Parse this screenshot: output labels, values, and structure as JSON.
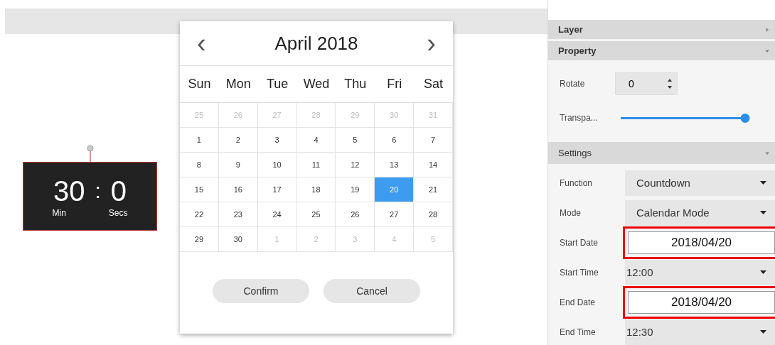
{
  "countdown": {
    "minutes": "30",
    "separator": ":",
    "seconds": "0",
    "minutes_label": "Min",
    "seconds_label": "Secs"
  },
  "calendar": {
    "title": "April 2018",
    "prev": "‹",
    "next": "›",
    "weekdays": [
      "Sun",
      "Mon",
      "Tue",
      "Wed",
      "Thu",
      "Fri",
      "Sat"
    ],
    "weeks": [
      [
        {
          "day": "25",
          "in_month": false,
          "selected": false
        },
        {
          "day": "26",
          "in_month": false,
          "selected": false
        },
        {
          "day": "27",
          "in_month": false,
          "selected": false
        },
        {
          "day": "28",
          "in_month": false,
          "selected": false
        },
        {
          "day": "29",
          "in_month": false,
          "selected": false
        },
        {
          "day": "30",
          "in_month": false,
          "selected": false
        },
        {
          "day": "31",
          "in_month": false,
          "selected": false
        }
      ],
      [
        {
          "day": "1",
          "in_month": true,
          "selected": false
        },
        {
          "day": "2",
          "in_month": true,
          "selected": false
        },
        {
          "day": "3",
          "in_month": true,
          "selected": false
        },
        {
          "day": "4",
          "in_month": true,
          "selected": false
        },
        {
          "day": "5",
          "in_month": true,
          "selected": false
        },
        {
          "day": "6",
          "in_month": true,
          "selected": false
        },
        {
          "day": "7",
          "in_month": true,
          "selected": false
        }
      ],
      [
        {
          "day": "8",
          "in_month": true,
          "selected": false
        },
        {
          "day": "9",
          "in_month": true,
          "selected": false
        },
        {
          "day": "10",
          "in_month": true,
          "selected": false
        },
        {
          "day": "11",
          "in_month": true,
          "selected": false
        },
        {
          "day": "12",
          "in_month": true,
          "selected": false
        },
        {
          "day": "13",
          "in_month": true,
          "selected": false
        },
        {
          "day": "14",
          "in_month": true,
          "selected": false
        }
      ],
      [
        {
          "day": "15",
          "in_month": true,
          "selected": false
        },
        {
          "day": "16",
          "in_month": true,
          "selected": false
        },
        {
          "day": "17",
          "in_month": true,
          "selected": false
        },
        {
          "day": "18",
          "in_month": true,
          "selected": false
        },
        {
          "day": "19",
          "in_month": true,
          "selected": false
        },
        {
          "day": "20",
          "in_month": true,
          "selected": true
        },
        {
          "day": "21",
          "in_month": true,
          "selected": false
        }
      ],
      [
        {
          "day": "22",
          "in_month": true,
          "selected": false
        },
        {
          "day": "23",
          "in_month": true,
          "selected": false
        },
        {
          "day": "24",
          "in_month": true,
          "selected": false
        },
        {
          "day": "25",
          "in_month": true,
          "selected": false
        },
        {
          "day": "26",
          "in_month": true,
          "selected": false
        },
        {
          "day": "27",
          "in_month": true,
          "selected": false
        },
        {
          "day": "28",
          "in_month": true,
          "selected": false
        }
      ],
      [
        {
          "day": "29",
          "in_month": true,
          "selected": false
        },
        {
          "day": "30",
          "in_month": true,
          "selected": false
        },
        {
          "day": "1",
          "in_month": false,
          "selected": false
        },
        {
          "day": "2",
          "in_month": false,
          "selected": false
        },
        {
          "day": "3",
          "in_month": false,
          "selected": false
        },
        {
          "day": "4",
          "in_month": false,
          "selected": false
        },
        {
          "day": "5",
          "in_month": false,
          "selected": false
        }
      ]
    ],
    "buttons": [
      "Confirm",
      "Cancel"
    ]
  },
  "panel": {
    "sections": [
      {
        "title": "Layer",
        "expanded": false
      },
      {
        "title": "Property",
        "expanded": true
      }
    ],
    "rotate": {
      "label": "Rotate",
      "value": "0"
    },
    "transparency": {
      "label": "Transpa...",
      "level": 1
    },
    "settings": {
      "title": "Settings",
      "expanded": true
    },
    "fields": [
      {
        "kind": "dropdown",
        "label": "Function",
        "value": "Countdown",
        "highlighted": false
      },
      {
        "kind": "dropdown",
        "label": "Mode",
        "value": "Calendar Mode",
        "highlighted": false
      },
      {
        "kind": "date",
        "label": "Start Date",
        "value": "2018/04/20",
        "highlighted": true
      },
      {
        "kind": "time",
        "label": "Start Time",
        "value": "12:00",
        "highlighted": false
      },
      {
        "kind": "date",
        "label": "End Date",
        "value": "2018/04/20",
        "highlighted": true
      },
      {
        "kind": "time",
        "label": "End Time",
        "value": "12:30",
        "highlighted": false
      }
    ]
  }
}
